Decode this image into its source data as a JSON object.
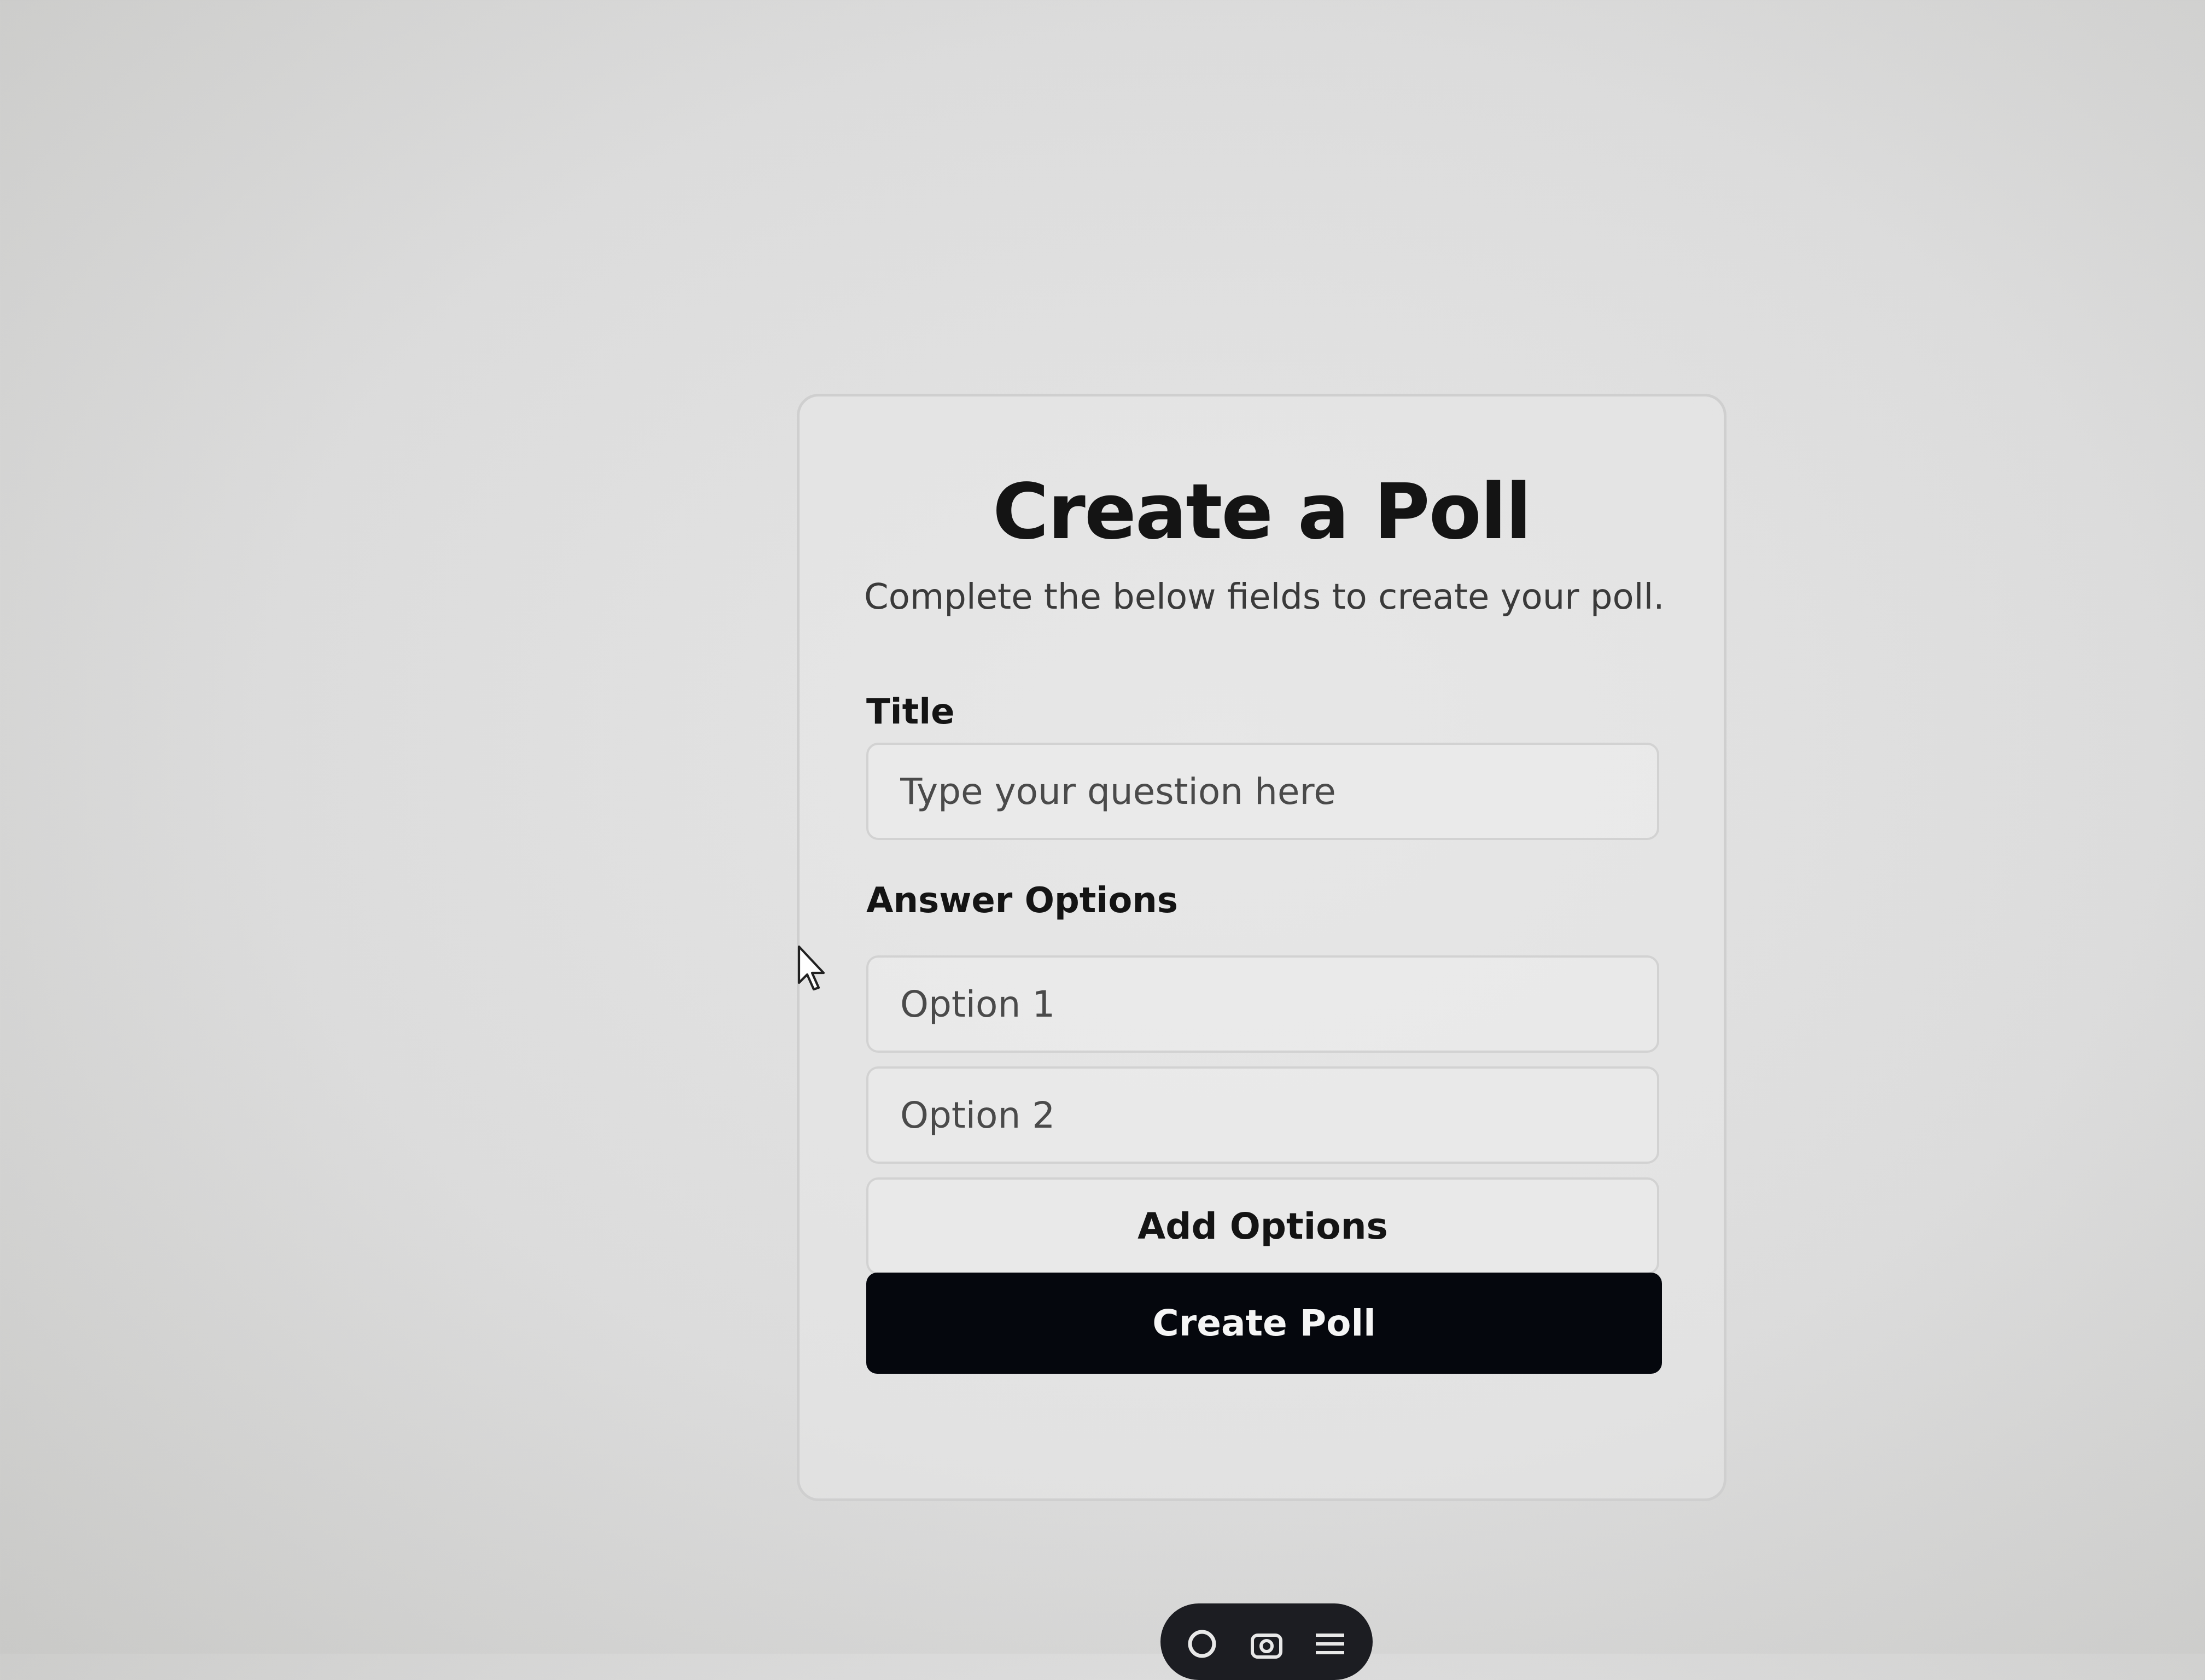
{
  "page": {
    "title": "Create a Poll",
    "subtitle": "Complete the below fields to create your poll."
  },
  "form": {
    "title_label": "Title",
    "title_placeholder": "Type your question here",
    "options_label": "Answer Options",
    "options": [
      {
        "placeholder": "Option 1"
      },
      {
        "placeholder": "Option 2"
      }
    ],
    "add_options_label": "Add Options",
    "submit_label": "Create Poll"
  },
  "toolbar": {
    "icons": [
      "search-icon",
      "camera-icon",
      "menu-icon"
    ]
  },
  "colors": {
    "primary_button": "#05070d",
    "card_border": "#cfcfcf",
    "toolbar_background": "#1c1d22"
  }
}
